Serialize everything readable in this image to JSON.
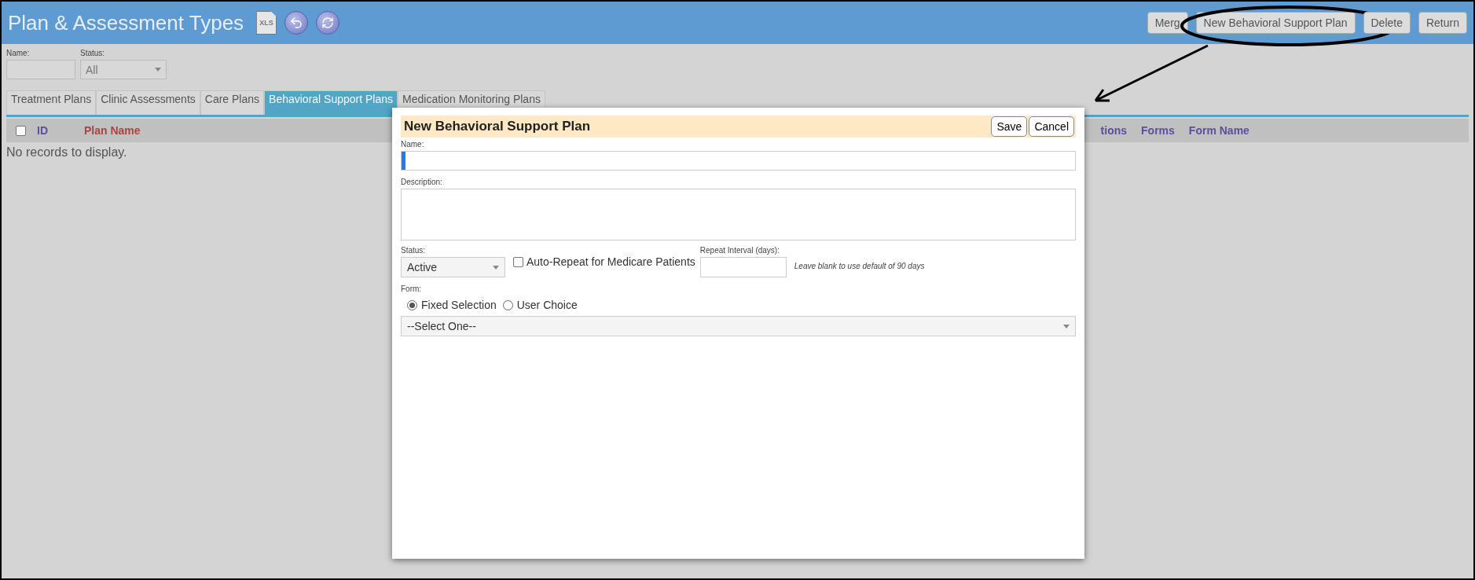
{
  "header": {
    "title": "Plan & Assessment Types",
    "xls_label": "XLS",
    "buttons": [
      {
        "label": "Merg",
        "circled": false
      },
      {
        "label": "New Behavioral Support Plan",
        "circled": true
      },
      {
        "label": "Delete",
        "circled": false
      },
      {
        "label": "Return",
        "circled": false
      }
    ]
  },
  "filters": {
    "name_label": "Name:",
    "status_label": "Status:",
    "status_value": "All"
  },
  "tabs": [
    {
      "label": "Treatment Plans",
      "selected": false
    },
    {
      "label": "Clinic Assessments",
      "selected": false
    },
    {
      "label": "Care Plans",
      "selected": false
    },
    {
      "label": "Behavioral Support Plans",
      "selected": true
    },
    {
      "label": "Medication Monitoring Plans",
      "selected": false
    }
  ],
  "table": {
    "select_all_checked": false,
    "columns_left": [
      "ID",
      "Plan Name"
    ],
    "columns_right": [
      "tions",
      "Forms",
      "Form Name"
    ],
    "empty_message": "No records to display."
  },
  "dialog": {
    "title": "New Behavioral Support Plan",
    "save": "Save",
    "cancel": "Cancel",
    "name_label": "Name:",
    "description_label": "Description:",
    "status_label": "Status:",
    "status_value": "Active",
    "auto_repeat": {
      "label": "Auto-Repeat for Medicare Patients",
      "checked": false
    },
    "repeat_label": "Repeat Interval (days):",
    "repeat_hint": "Leave blank to use default of 90 days",
    "form_label": "Form:",
    "form_options": [
      {
        "label": "Fixed Selection",
        "selected": true
      },
      {
        "label": "User Choice",
        "selected": false
      }
    ],
    "form_select": "--Select One--"
  }
}
